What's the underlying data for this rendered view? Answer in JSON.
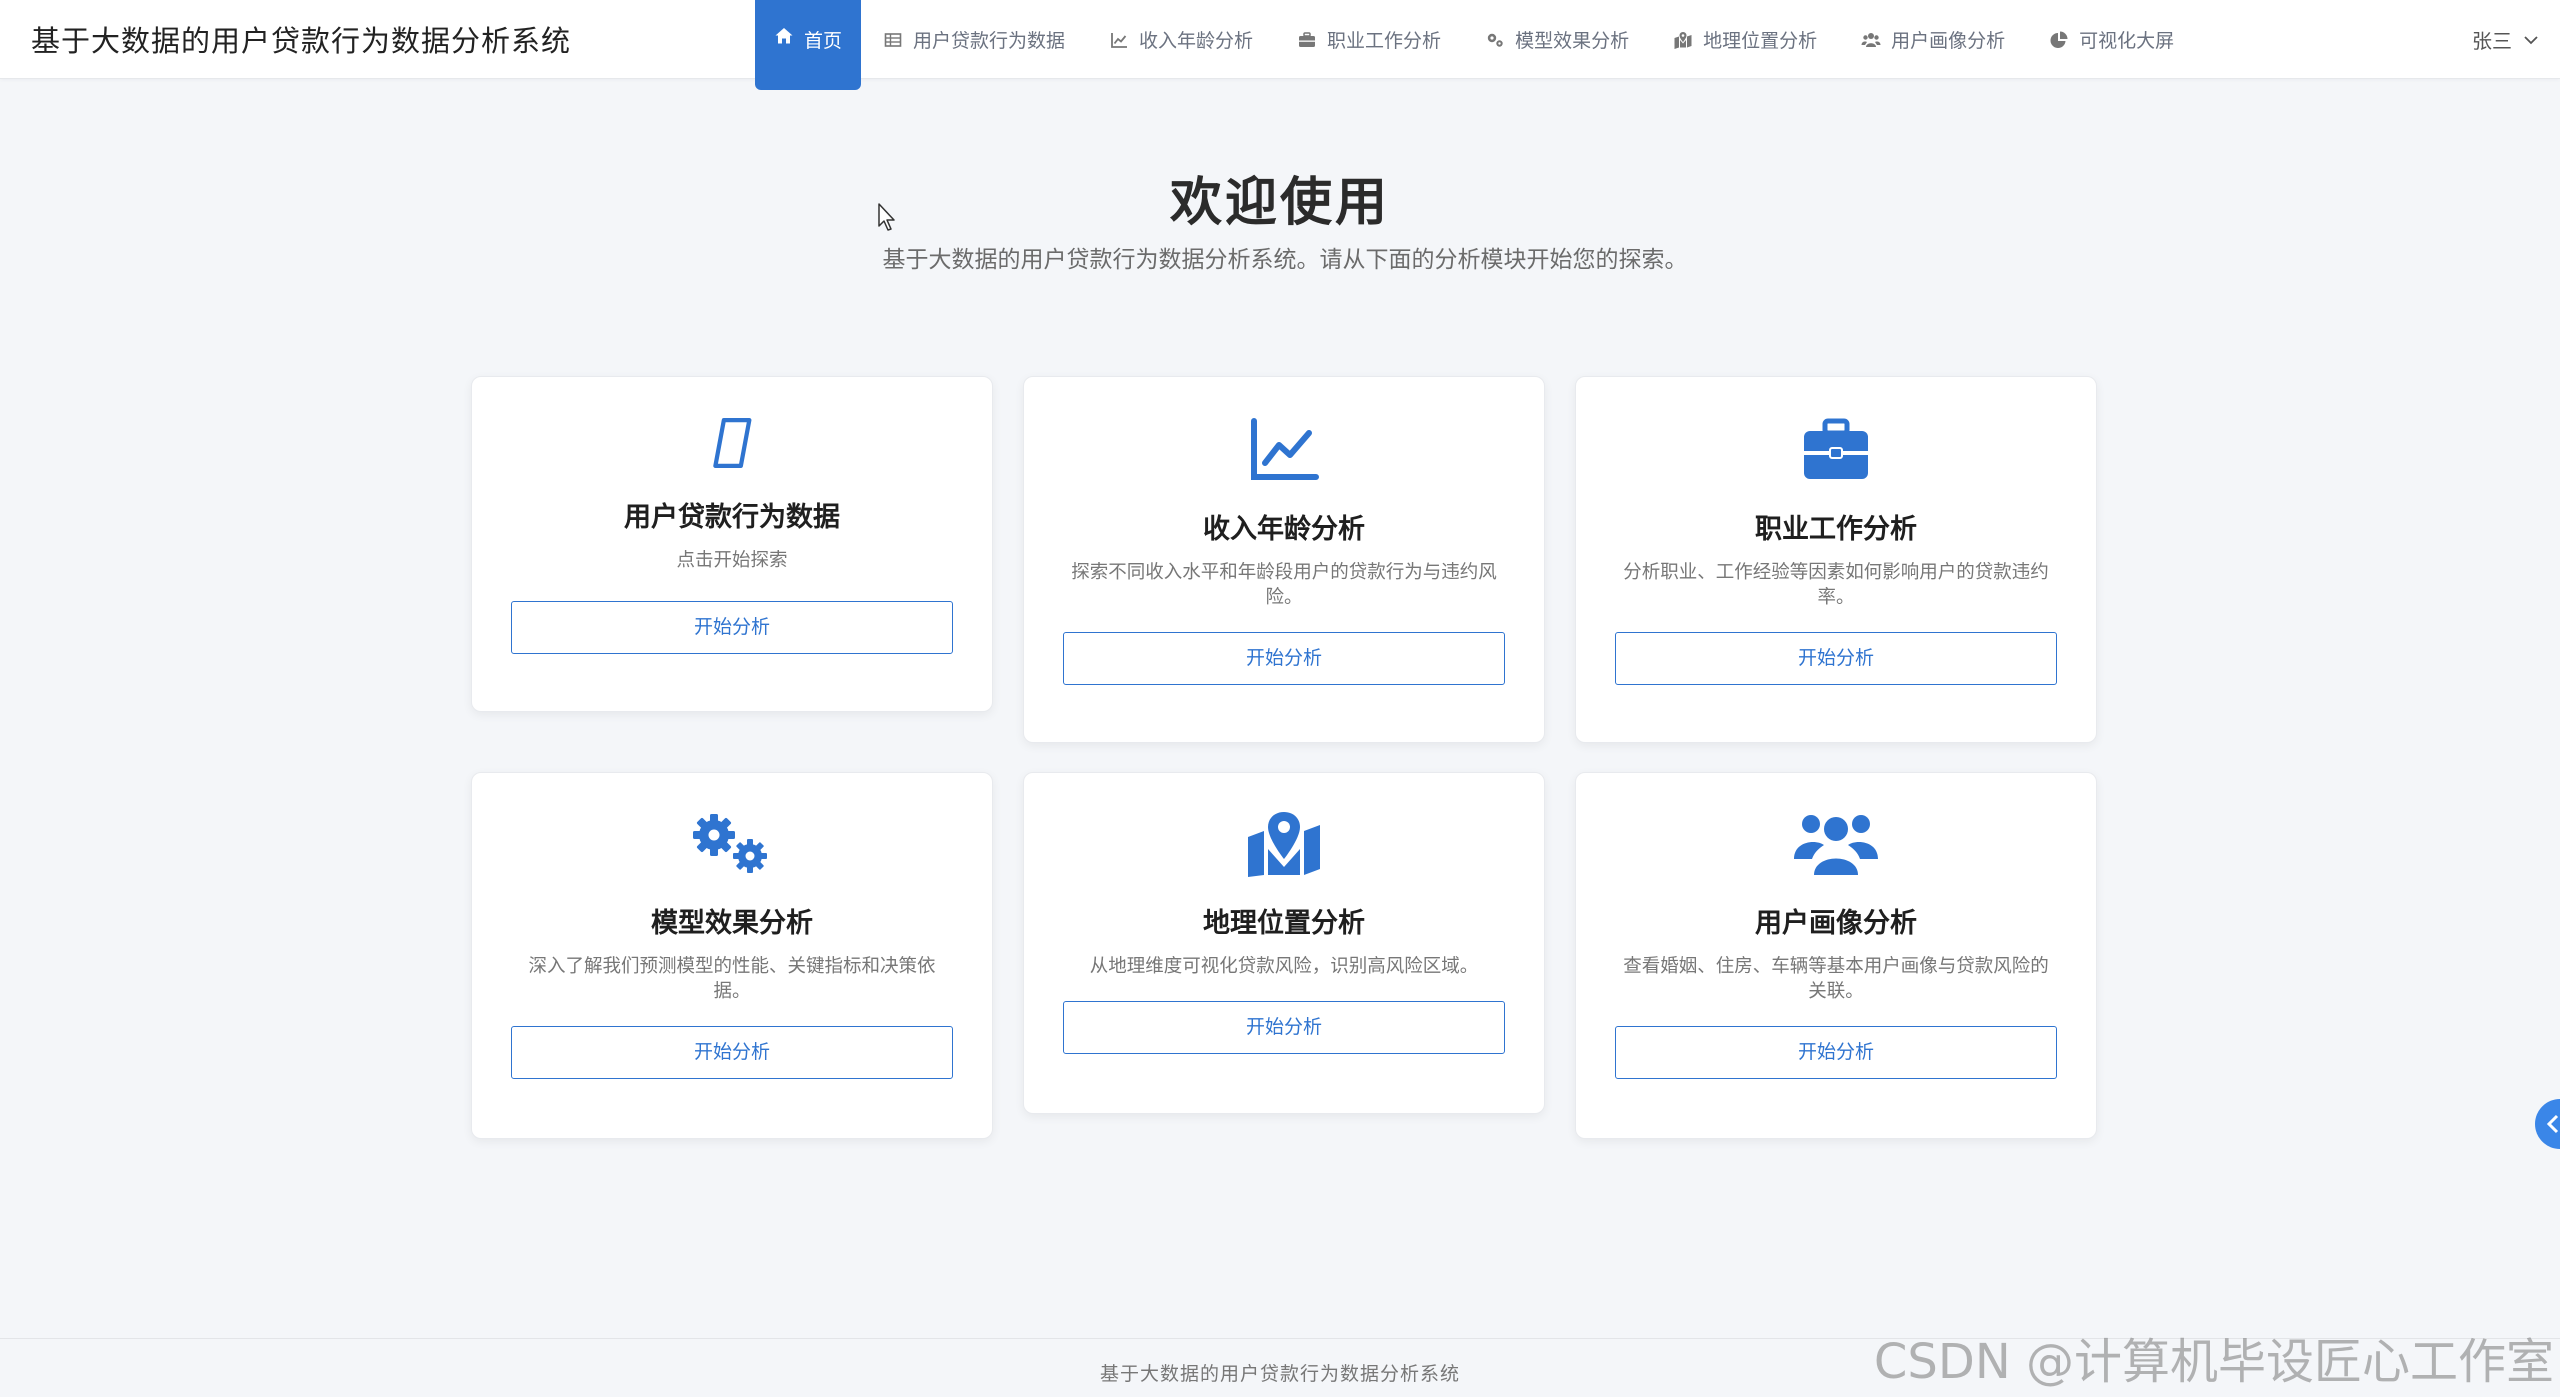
{
  "app": {
    "title": "基于大数据的用户贷款行为数据分析系统"
  },
  "nav": {
    "items": [
      {
        "label": "首页",
        "icon": "home-icon"
      },
      {
        "label": "用户贷款行为数据",
        "icon": "table-icon"
      },
      {
        "label": "收入年龄分析",
        "icon": "line-chart-icon"
      },
      {
        "label": "职业工作分析",
        "icon": "briefcase-icon"
      },
      {
        "label": "模型效果分析",
        "icon": "cogs-icon"
      },
      {
        "label": "地理位置分析",
        "icon": "map-icon"
      },
      {
        "label": "用户画像分析",
        "icon": "users-icon"
      },
      {
        "label": "可视化大屏",
        "icon": "pie-chart-icon"
      }
    ],
    "active_index": 0
  },
  "user": {
    "name": "张三",
    "icon": "chevron-down-icon"
  },
  "hero": {
    "title": "欢迎使用",
    "subtitle": "基于大数据的用户贷款行为数据分析系统。请从下面的分析模块开始您的探索。"
  },
  "cards": [
    {
      "title": "用户贷款行为数据",
      "desc": "点击开始探索",
      "button": "开始分析",
      "icon": "table-icon"
    },
    {
      "title": "收入年龄分析",
      "desc": "探索不同收入水平和年龄段用户的贷款行为与违约风险。",
      "button": "开始分析",
      "icon": "line-chart-icon"
    },
    {
      "title": "职业工作分析",
      "desc": "分析职业、工作经验等因素如何影响用户的贷款违约率。",
      "button": "开始分析",
      "icon": "briefcase-icon"
    },
    {
      "title": "模型效果分析",
      "desc": "深入了解我们预测模型的性能、关键指标和决策依据。",
      "button": "开始分析",
      "icon": "cogs-icon"
    },
    {
      "title": "地理位置分析",
      "desc": "从地理维度可视化贷款风险，识别高风险区域。",
      "button": "开始分析",
      "icon": "map-icon"
    },
    {
      "title": "用户画像分析",
      "desc": "查看婚姻、住房、车辆等基本用户画像与贷款风险的关联。",
      "button": "开始分析",
      "icon": "users-icon"
    }
  ],
  "footer": {
    "text": "基于大数据的用户贷款行为数据分析系统"
  },
  "watermark": {
    "text": "CSDN @计算机毕设匠心工作室"
  },
  "colors": {
    "primary": "#2f74d0",
    "background": "#f4f6f9",
    "card": "#ffffff"
  }
}
